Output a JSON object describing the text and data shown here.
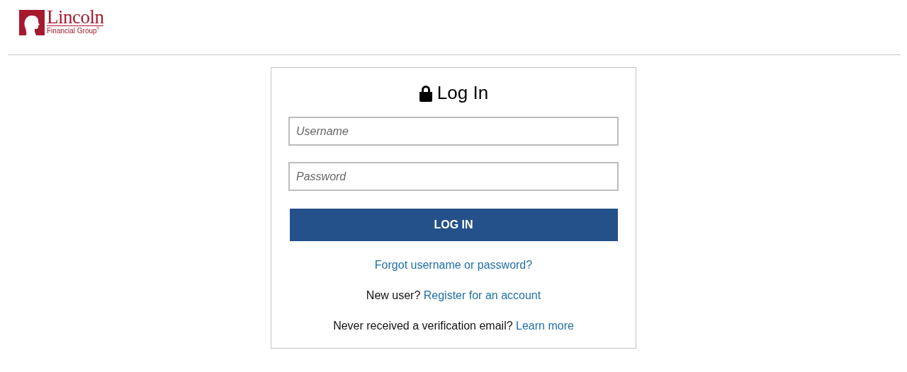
{
  "logo": {
    "name": "Lincoln",
    "subtitle": "Financial Group",
    "mark": "®"
  },
  "login": {
    "title": "Log In",
    "fields": [
      {
        "placeholder": "Username"
      },
      {
        "placeholder": "Password"
      }
    ],
    "submit": "LOG IN",
    "forgot_link": "Forgot username or password?",
    "prompts": [
      {
        "text": "New user?",
        "link": "Register for an account"
      },
      {
        "text": "Never received a verification email?",
        "link": "Learn more"
      }
    ]
  }
}
